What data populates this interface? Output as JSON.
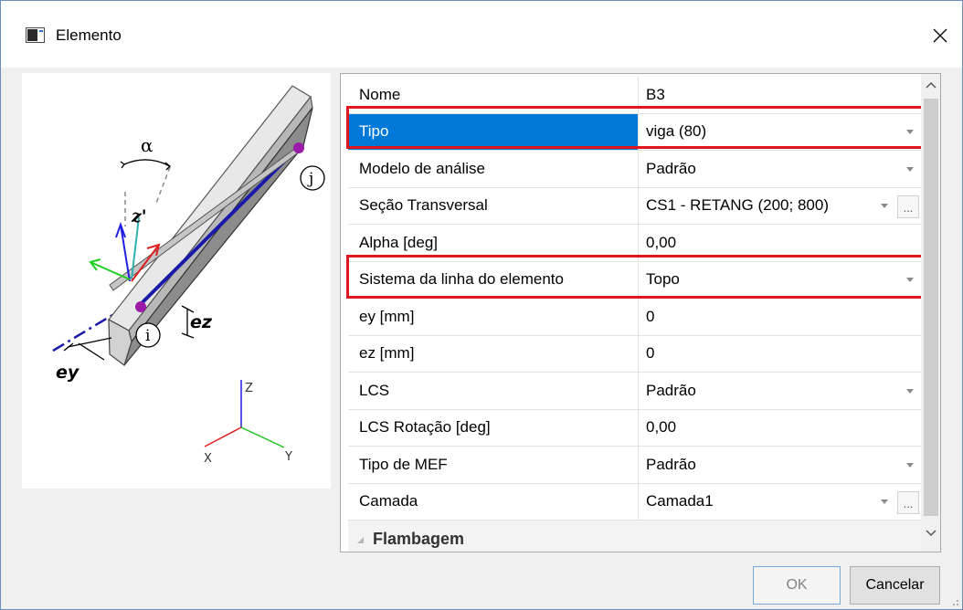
{
  "window": {
    "title": "Elemento",
    "app_icon": "window-icon",
    "close_icon": "close-icon"
  },
  "preview": {
    "labels": {
      "alpha": "α",
      "z_prime": "z'",
      "node_j": "j",
      "node_i": "i",
      "ez": "ez",
      "ey": "ey",
      "axis_z": "Z",
      "axis_x": "X",
      "axis_y": "Y"
    }
  },
  "properties": [
    {
      "name": "Nome",
      "value": "B3",
      "dropdown": false,
      "ellipsis": false
    },
    {
      "name": "Tipo",
      "value": "viga (80)",
      "dropdown": true,
      "ellipsis": false
    },
    {
      "name": "Modelo de análise",
      "value": "Padrão",
      "dropdown": true,
      "ellipsis": false
    },
    {
      "name": "Seção Transversal",
      "value": "CS1 - RETANG (200; 800)",
      "dropdown": true,
      "ellipsis": true
    },
    {
      "name": "Alpha [deg]",
      "value": "0,00",
      "dropdown": false,
      "ellipsis": false
    },
    {
      "name": "Sistema da linha do elemento",
      "value": "Topo",
      "dropdown": true,
      "ellipsis": false
    },
    {
      "name": "ey [mm]",
      "value": "0",
      "dropdown": false,
      "ellipsis": false
    },
    {
      "name": "ez [mm]",
      "value": "0",
      "dropdown": false,
      "ellipsis": false
    },
    {
      "name": "LCS",
      "value": "Padrão",
      "dropdown": true,
      "ellipsis": false
    },
    {
      "name": "LCS Rotação [deg]",
      "value": "0,00",
      "dropdown": false,
      "ellipsis": false
    },
    {
      "name": "Tipo de MEF",
      "value": "Padrão",
      "dropdown": true,
      "ellipsis": false
    },
    {
      "name": "Camada",
      "value": "Camada1",
      "dropdown": true,
      "ellipsis": true
    }
  ],
  "ellipsis_label": "...",
  "category": {
    "label": "Flambagem"
  },
  "buttons": {
    "ok": "OK",
    "cancel": "Cancelar"
  },
  "colors": {
    "selection": "#0078d7",
    "highlight": "#e0161f",
    "node": "#9b1aa8",
    "member_edge": "#1a1aa8"
  }
}
